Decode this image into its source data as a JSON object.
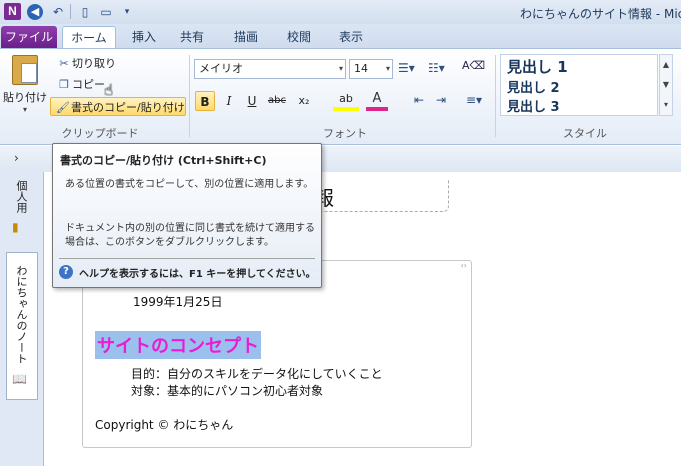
{
  "titlebar": {
    "app_icon_letter": "N",
    "window_title": "わにちゃんのサイト情報 - Micros"
  },
  "tabs": {
    "file": "ファイル",
    "home": "ホーム",
    "insert": "挿入",
    "share": "共有",
    "draw": "描画",
    "review": "校閲",
    "view": "表示"
  },
  "clipboard": {
    "paste": "貼り付け",
    "cut": "切り取り",
    "copy": "コピー",
    "format_painter": "書式のコピー/貼り付け",
    "group_label": "クリップボード"
  },
  "font": {
    "name": "メイリオ",
    "size": "14",
    "group_label": "フォント",
    "bold": "B",
    "italic": "I",
    "underline": "U",
    "strike": "abc",
    "subscript": "x₂",
    "highlight": "ab",
    "font_color": "A"
  },
  "styles": {
    "heading1": "見出し 1",
    "heading2": "見出し 2",
    "heading3": "見出し 3",
    "group_label": "スタイル"
  },
  "notebooks": {
    "personal": "個人用",
    "wani": "わにちゃんのノート"
  },
  "page": {
    "title": "報",
    "created_date": "1999年1月25日",
    "concept_heading": "サイトのコンセプト",
    "purpose": "目的：自分のスキルをデータ化にしていくこと",
    "target": "対象：基本的にパソコン初心者対象",
    "copyright": "Copyright © わにちゃん"
  },
  "tooltip": {
    "title": "書式のコピー/貼り付け (Ctrl+Shift+C)",
    "para1": "ある位置の書式をコピーして、別の位置に適用します。",
    "para2": "ドキュメント内の別の位置に同じ書式を続けて適用する場合は、このボタンをダブルクリックします。",
    "help": "ヘルプを表示するには、F1 キーを押してください。"
  },
  "colors": {
    "file_tab": "#7b2a91",
    "heading_text": "#e81cd3",
    "heading_highlight": "#9cc0ee",
    "active_button": "#ffd969"
  }
}
